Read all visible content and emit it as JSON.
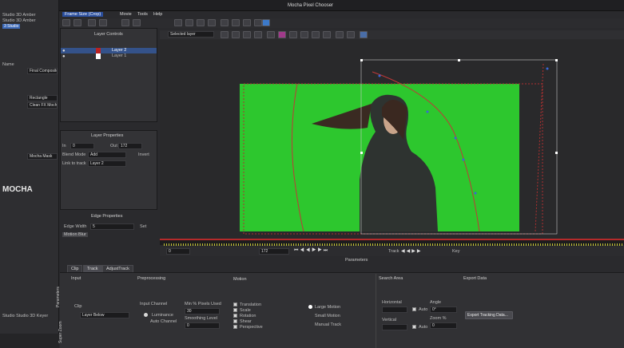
{
  "window": {
    "title": "Mocha Pixel Chooser",
    "menu": [
      "Frame Size (Crop)",
      "Movie",
      "Tools",
      "Help"
    ]
  },
  "left": {
    "top_rows": [
      "Studio 3D Amber",
      "Studio 3D Amber",
      "3 Studio"
    ],
    "rows": [
      "Name",
      "Final Compositor",
      "Rectangle",
      "Clean FX Mocha",
      "Mocha Mask",
      "MOCHA"
    ],
    "mocha": "MOCHA",
    "studio": "Studio Studio 3D Keyer"
  },
  "layers": {
    "title": "Layer Controls",
    "items": [
      "Layer 2",
      "Layer 1"
    ]
  },
  "layer_props": {
    "title": "Layer Properties",
    "in_label": "In",
    "in_val": "0",
    "out_label": "Out",
    "out_val": "172",
    "blend_label": "Blend Mode",
    "blend_val": "Add",
    "invert": "Invert",
    "link_label": "Link to track",
    "link_val": "Layer 2"
  },
  "edge_props": {
    "title": "Edge Properties",
    "edge_label": "Edge Width",
    "edge_val": "5",
    "set": "Set",
    "motion_blur": "Motion Blur"
  },
  "toolbar": {
    "layer_select": "Selected layer"
  },
  "timeline": {
    "start": "0",
    "end": "172",
    "track": "Track",
    "key": "Key"
  },
  "params": {
    "title": "Parameters",
    "tabs": [
      "Clip",
      "Track",
      "AdjustTrack"
    ],
    "side_tab": "Parameters",
    "side_tab2": "Super Zoom",
    "input": {
      "label": "Input",
      "clip_label": "Clip",
      "clip_val": "Layer Below"
    },
    "pre": {
      "label": "Preprocessing",
      "ic_label": "Input Channel",
      "lum": "Luminance",
      "auto": "Auto Channel",
      "min_label": "Min % Pixels Used",
      "min_val": "30",
      "smooth_label": "Smoothing Level",
      "smooth_val": "0"
    },
    "motion": {
      "label": "Motion",
      "checks": [
        "Translation",
        "Scale",
        "Rotation",
        "Shear",
        "Perspective"
      ],
      "radios": [
        "Large Motion",
        "Small Motion",
        "Manual Track"
      ]
    },
    "search": {
      "label": "Search Area",
      "horiz": "Horizontal",
      "vert": "Vertical",
      "auto1": "Auto",
      "auto2": "Auto",
      "angle_label": "Angle",
      "angle_val": "0°",
      "zoom_label": "Zoom %",
      "zoom_val": "0"
    },
    "export": {
      "label": "Export Data",
      "btn": "Export Tracking Data..."
    }
  },
  "colors": {
    "green": "#2dc72e",
    "spline": "#c03838",
    "spline_blue": "#3a66d8",
    "bg": "#2a2a2d"
  }
}
